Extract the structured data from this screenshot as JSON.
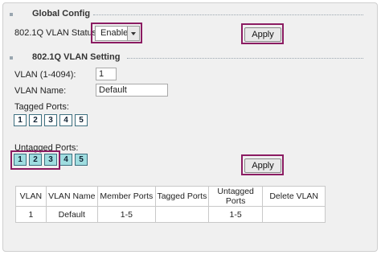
{
  "global_config": {
    "title": "Global Config",
    "status_label": "802.1Q VLAN Status:",
    "status_value": "Enable",
    "apply_label": "Apply"
  },
  "vlan_setting": {
    "title": "802.1Q VLAN Setting",
    "vlan_id_label": "VLAN (1-4094):",
    "vlan_id_value": "1",
    "vlan_name_label": "VLAN Name:",
    "vlan_name_value": "Default",
    "tagged_label": "Tagged Ports:",
    "tagged_ports": [
      {
        "label": "1",
        "checked": false
      },
      {
        "label": "2",
        "checked": false
      },
      {
        "label": "3",
        "checked": false
      },
      {
        "label": "4",
        "checked": false
      },
      {
        "label": "5",
        "checked": false
      }
    ],
    "untagged_label": "Untagged Ports:",
    "untagged_ports": [
      {
        "label": "1",
        "checked": true
      },
      {
        "label": "2",
        "checked": true
      },
      {
        "label": "3",
        "checked": true
      },
      {
        "label": "4",
        "checked": true
      },
      {
        "label": "5",
        "checked": true
      }
    ],
    "apply_label": "Apply"
  },
  "vlan_table": {
    "headers": [
      "VLAN",
      "VLAN Name",
      "Member Ports",
      "Tagged Ports",
      "Untagged Ports",
      "Delete VLAN"
    ],
    "rows": [
      [
        "1",
        "Default",
        "1-5",
        "",
        "1-5",
        ""
      ]
    ]
  },
  "colors": {
    "highlight": "#8b1c62",
    "port_checked": "#9fdde0",
    "panel_bg": "#f0f0f0"
  }
}
